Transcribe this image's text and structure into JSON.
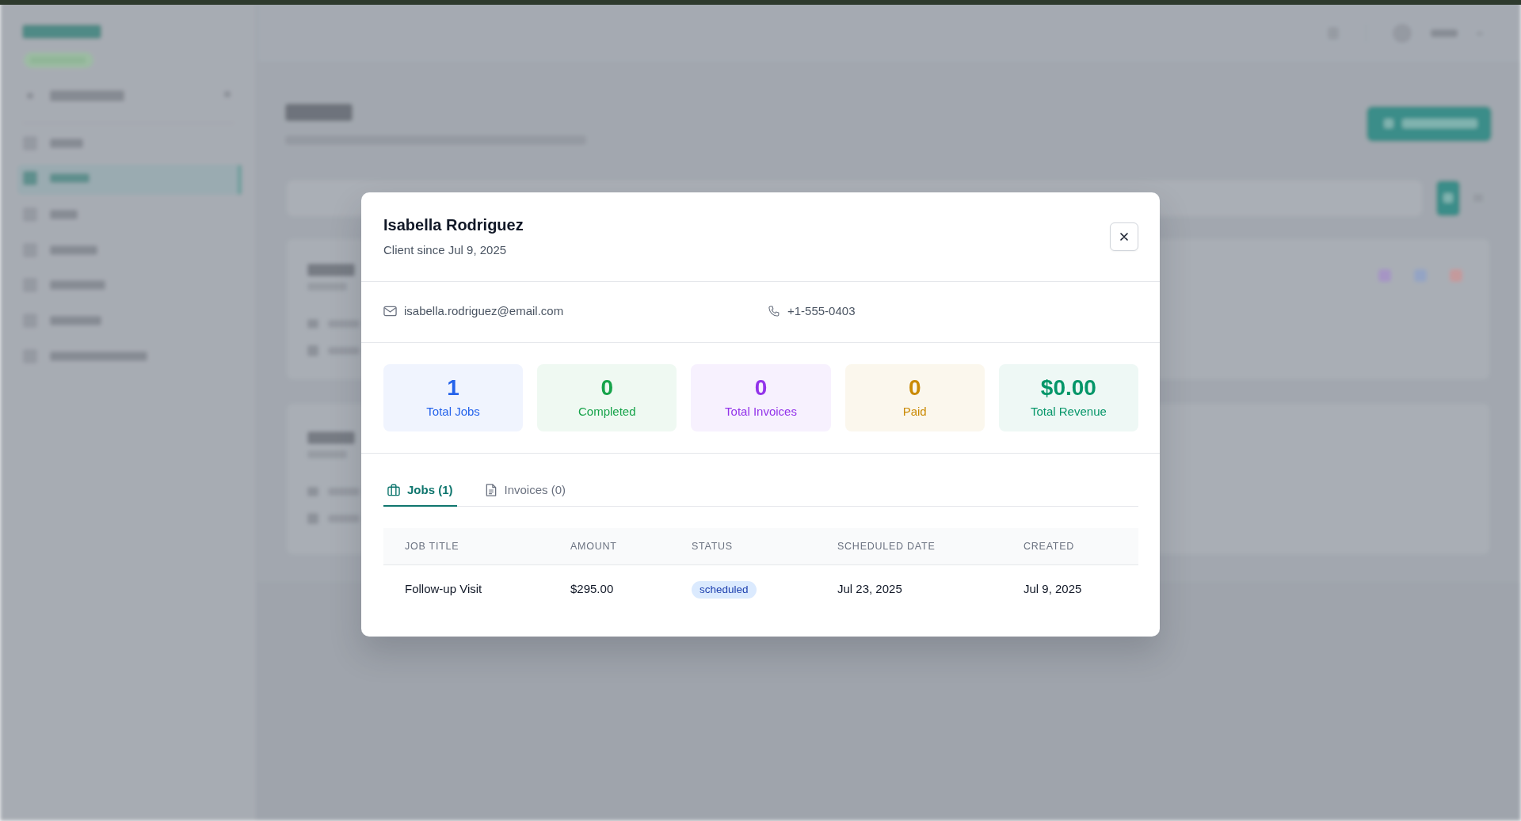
{
  "modal": {
    "title": "Isabella Rodriguez",
    "subtitle": "Client since Jul 9, 2025",
    "contacts": [
      {
        "kind": "email",
        "text": "isabella.rodriguez@email.com"
      },
      {
        "kind": "phone",
        "text": "+1-555-0403"
      }
    ],
    "stats": [
      {
        "value": "1",
        "label": "Total Jobs",
        "color": "#2563eb"
      },
      {
        "value": "0",
        "label": "Completed",
        "color": "#16a34a"
      },
      {
        "value": "0",
        "label": "Total Invoices",
        "color": "#9333ea"
      },
      {
        "value": "0",
        "label": "Paid",
        "color": "#ca8a04"
      },
      {
        "value": "$0.00",
        "label": "Total Revenue",
        "color": "#059669"
      }
    ],
    "tabs": [
      {
        "kind": "jobs",
        "label": "Jobs (1)",
        "selected": true
      },
      {
        "kind": "invoices",
        "label": "Invoices (0)",
        "selected": false
      }
    ],
    "table": {
      "columns": [
        "JOB TITLE",
        "AMOUNT",
        "STATUS",
        "SCHEDULED DATE",
        "CREATED"
      ],
      "rows": [
        {
          "job_title": "Follow-up Visit",
          "amount": "$295.00",
          "status": "scheduled",
          "scheduled_date": "Jul 23, 2025",
          "created": "Jul 9, 2025"
        }
      ]
    }
  }
}
